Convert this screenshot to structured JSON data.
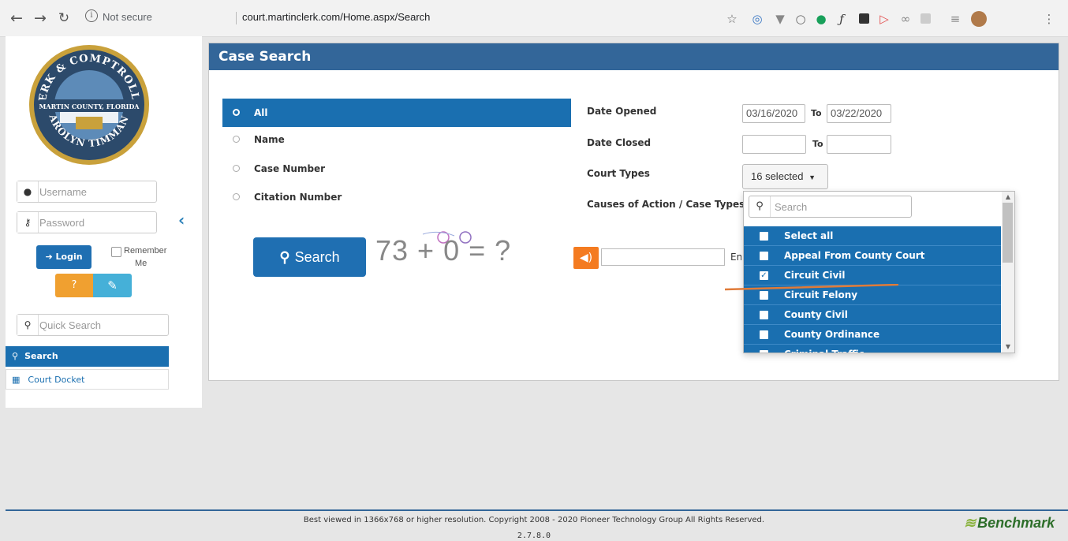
{
  "browser": {
    "security_label": "Not secure",
    "url": "court.martinclerk.com/Home.aspx/Search"
  },
  "logo": {
    "top_text": "CLERK & COMPTROLLER",
    "middle_text": "MARTIN COUNTY, FLORIDA",
    "bottom_text": "CAROLYN TIMMANN"
  },
  "sidebar": {
    "username_placeholder": "Username",
    "password_placeholder": "Password",
    "login_label": "Login",
    "remember_line1": "Remember",
    "remember_line2": "Me",
    "quick_search_placeholder": "Quick Search",
    "items": [
      {
        "label": "Search",
        "icon": "search-icon",
        "active": true
      },
      {
        "label": "Court Docket",
        "icon": "calendar-icon",
        "active": false
      }
    ]
  },
  "panel": {
    "title": "Case Search",
    "search_types": [
      {
        "label": "All",
        "selected": true
      },
      {
        "label": "Name",
        "selected": false
      },
      {
        "label": "Case Number",
        "selected": false
      },
      {
        "label": "Citation Number",
        "selected": false
      }
    ],
    "search_button": "Search",
    "captcha_text": "73 + 0 = ?",
    "captcha_label": "Enter"
  },
  "form": {
    "date_opened_label": "Date Opened",
    "date_opened_from": "03/16/2020",
    "date_opened_to": "03/22/2020",
    "date_closed_label": "Date Closed",
    "date_closed_from": "",
    "date_closed_to": "",
    "to_label": "To",
    "court_types_label": "Court Types",
    "court_types_value": "16 selected",
    "causes_label": "Causes of Action / Case Types"
  },
  "dropdown": {
    "search_placeholder": "Search",
    "items": [
      {
        "label": "Select all",
        "checked": false
      },
      {
        "label": "Appeal From County Court",
        "checked": false
      },
      {
        "label": "Circuit Civil",
        "checked": true
      },
      {
        "label": "Circuit Felony",
        "checked": false
      },
      {
        "label": "County Civil",
        "checked": false
      },
      {
        "label": "County Ordinance",
        "checked": false
      },
      {
        "label": "Criminal Traffic",
        "checked": false
      }
    ]
  },
  "footer": {
    "copyright": "Best viewed in 1366x768 or higher resolution. Copyright 2008 - 2020 Pioneer Technology Group All Rights Reserved.",
    "version": "2.7.8.0",
    "brand": "Benchmark"
  },
  "colors": {
    "primary": "#1a6fb0",
    "header": "#336699",
    "warning": "#f0a030",
    "info": "#45b0d8",
    "audio": "#f47b20",
    "annotation": "#e07b39"
  }
}
